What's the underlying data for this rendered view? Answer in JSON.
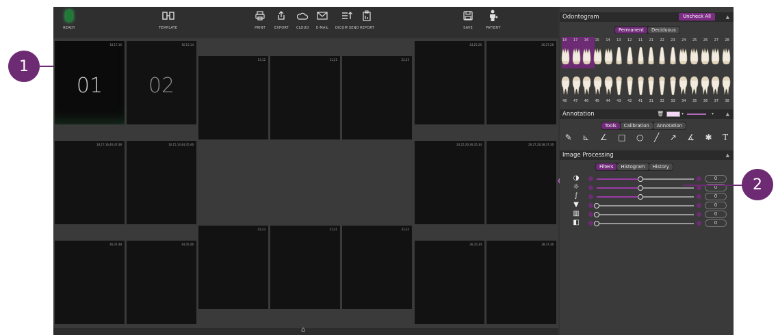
{
  "callouts": [
    "1",
    "2"
  ],
  "toolbar": {
    "ready": "READY",
    "template": "TEMPLATE",
    "print": "PRINT",
    "export": "EXPORT",
    "cloud": "CLOUD",
    "email": "E-MAIL",
    "dicom_send": "DICOM SEND",
    "report": "REPORT",
    "save": "SAVE",
    "patient": "PATIENT"
  },
  "slots": [
    {
      "label": "01",
      "teeth": "18,17,16"
    },
    {
      "label": "02",
      "teeth": "16,15,14"
    },
    {
      "label": "",
      "teeth": "13,12"
    },
    {
      "label": "",
      "teeth": "11,21"
    },
    {
      "label": "",
      "teeth": "22,23"
    },
    {
      "label": "",
      "teeth": "24,25,26"
    },
    {
      "label": "",
      "teeth": "26,27,28"
    },
    {
      "label": "",
      "teeth": "18,17,16,46,47,48"
    },
    {
      "label": "",
      "teeth": "16,15,14,44,45,46"
    },
    {
      "label": "",
      "teeth": "24,25,26,36,35,34"
    },
    {
      "label": "",
      "teeth": "26,27,28,38,37,36"
    },
    {
      "label": "",
      "teeth": "43,33"
    },
    {
      "label": "",
      "teeth": "31,41"
    },
    {
      "label": "",
      "teeth": "33,32"
    },
    {
      "label": "",
      "teeth": "46,47,48"
    },
    {
      "label": "",
      "teeth": "44,45,46"
    },
    {
      "label": "",
      "teeth": "36,35,34"
    },
    {
      "label": "",
      "teeth": "38,37,36"
    }
  ],
  "odontogram": {
    "title": "Odontogram",
    "uncheck_all": "Uncheck All",
    "tabs": [
      "Permanent",
      "Deciduous"
    ],
    "active_tab": "Permanent",
    "upper_numbers": [
      "18",
      "17",
      "16",
      "15",
      "14",
      "13",
      "12",
      "11",
      "21",
      "22",
      "23",
      "24",
      "25",
      "26",
      "27",
      "28"
    ],
    "lower_numbers": [
      "48",
      "47",
      "46",
      "45",
      "44",
      "43",
      "42",
      "41",
      "31",
      "32",
      "33",
      "34",
      "35",
      "36",
      "37",
      "38"
    ],
    "selected_upper": [
      "18",
      "17",
      "16"
    ]
  },
  "annotation": {
    "title": "Annotation",
    "tabs": [
      "Tools",
      "Calibration",
      "Annotation"
    ],
    "active_tab": "Tools",
    "color": "#f4d6f6",
    "tool_icons": [
      "pen-icon",
      "ruler-angle-icon",
      "angle-icon",
      "rectangle-icon",
      "circle-icon",
      "line-icon",
      "arrow-icon",
      "angle-measure-icon",
      "asterisk-icon",
      "text-icon"
    ]
  },
  "image_processing": {
    "title": "Image Processing",
    "tabs": [
      "Filters",
      "Histogram",
      "History"
    ],
    "active_tab": "Filters",
    "sliders": [
      {
        "icon": "contrast-icon",
        "value": "0",
        "level": 0.45
      },
      {
        "icon": "brightness-icon",
        "value": "0",
        "level": 0.45
      },
      {
        "icon": "gamma-icon",
        "value": "0",
        "level": 0.45
      },
      {
        "icon": "filter-icon",
        "value": "0",
        "level": 0.0
      },
      {
        "icon": "sharpen-icon",
        "value": "0",
        "level": 0.0
      },
      {
        "icon": "invert-icon",
        "value": "0",
        "level": 0.0
      }
    ]
  }
}
